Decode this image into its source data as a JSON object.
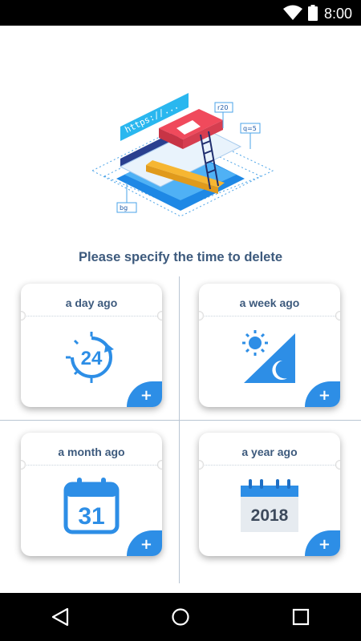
{
  "status_bar": {
    "time": "8:00"
  },
  "illustration": {
    "url_text": "https://...",
    "tag_r20": "r20",
    "tag_q5": "q=5",
    "tag_bg": "bg"
  },
  "prompt": "Please specify the time to delete",
  "cards": [
    {
      "label": "a day ago",
      "icon": "24-hour-icon",
      "icon_text": "24"
    },
    {
      "label": "a week ago",
      "icon": "day-night-icon"
    },
    {
      "label": "a month ago",
      "icon": "calendar-icon",
      "icon_text": "31"
    },
    {
      "label": "a year ago",
      "icon": "year-calendar-icon",
      "icon_text": "2018"
    }
  ],
  "add_symbol": "+",
  "colors": {
    "accent": "#2d8ee6",
    "text": "#3d5a7d",
    "divider": "#b9c5d3"
  },
  "nav_bar": {
    "back": "back-icon",
    "home": "home-icon",
    "recents": "recents-icon"
  }
}
